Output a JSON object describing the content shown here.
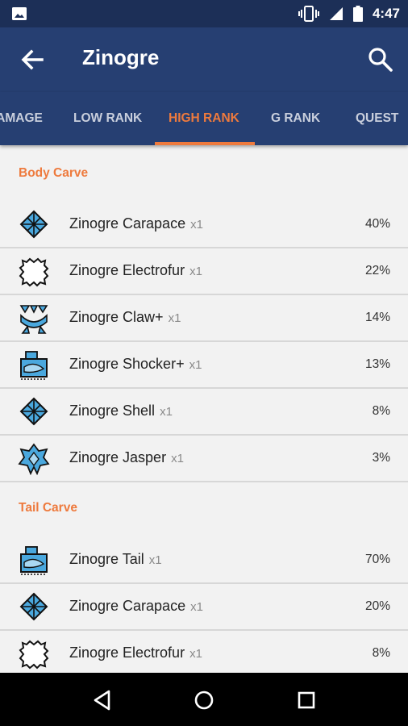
{
  "status_bar": {
    "time": "4:47"
  },
  "app_bar": {
    "title": "Zinogre"
  },
  "tabs": [
    {
      "label": "DAMAGE",
      "active": false
    },
    {
      "label": "LOW RANK",
      "active": false
    },
    {
      "label": "HIGH RANK",
      "active": true
    },
    {
      "label": "G RANK",
      "active": false
    },
    {
      "label": "QUEST",
      "active": false
    }
  ],
  "sections": [
    {
      "title": "Body Carve",
      "items": [
        {
          "name": "Zinogre Carapace",
          "qty": "x1",
          "pct": "40%",
          "icon": "carapace-icon"
        },
        {
          "name": "Zinogre Electrofur",
          "qty": "x1",
          "pct": "22%",
          "icon": "fur-icon"
        },
        {
          "name": "Zinogre Claw+",
          "qty": "x1",
          "pct": "14%",
          "icon": "claw-icon"
        },
        {
          "name": "Zinogre Shocker+",
          "qty": "x1",
          "pct": "13%",
          "icon": "monster-part-icon"
        },
        {
          "name": "Zinogre Shell",
          "qty": "x1",
          "pct": "8%",
          "icon": "shell-icon"
        },
        {
          "name": "Zinogre Jasper",
          "qty": "x1",
          "pct": "3%",
          "icon": "jasper-icon"
        }
      ]
    },
    {
      "title": "Tail Carve",
      "items": [
        {
          "name": "Zinogre Tail",
          "qty": "x1",
          "pct": "70%",
          "icon": "monster-part-icon"
        },
        {
          "name": "Zinogre Carapace",
          "qty": "x1",
          "pct": "20%",
          "icon": "carapace-icon"
        },
        {
          "name": "Zinogre Electrofur",
          "qty": "x1",
          "pct": "8%",
          "icon": "fur-icon"
        }
      ]
    }
  ],
  "colors": {
    "primary": "#263f72",
    "status_bar": "#1c2f57",
    "accent": "#ee7a3d",
    "icon_blue": "#4aa8de"
  }
}
